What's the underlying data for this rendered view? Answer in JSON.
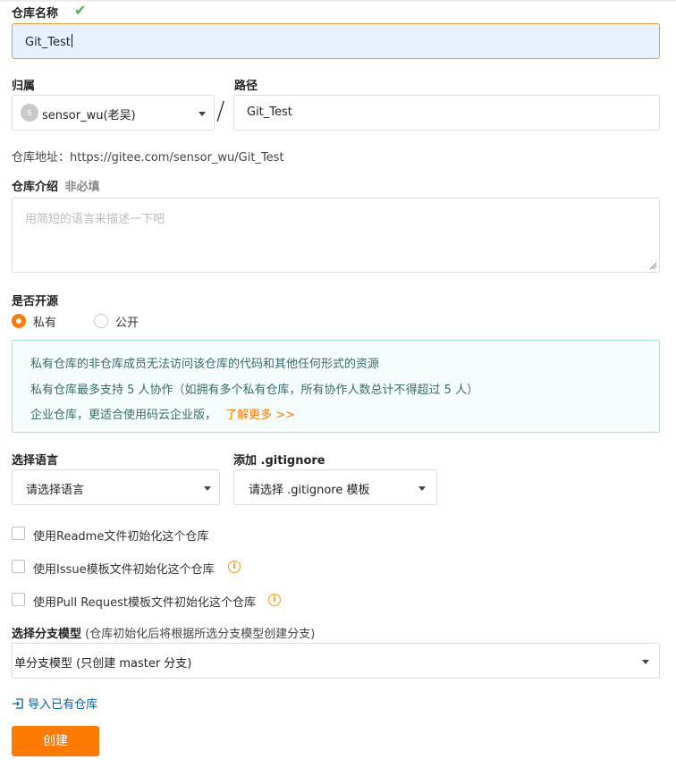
{
  "repo_name": {
    "label": "仓库名称",
    "value": "Git_Test"
  },
  "owner": {
    "label": "归属",
    "avatar_letter": "s",
    "value": "sensor_wu(老吴)"
  },
  "path": {
    "label": "路径",
    "value": "Git_Test",
    "separator": "/"
  },
  "repo_address": "仓库地址：https://gitee.com/sensor_wu/Git_Test",
  "description": {
    "label": "仓库介绍",
    "optional": "非必填",
    "placeholder": "用简短的语言来描述一下吧"
  },
  "visibility": {
    "label": "是否开源",
    "options": [
      {
        "label": "私有",
        "selected": true
      },
      {
        "label": "公开",
        "selected": false
      }
    ]
  },
  "private_notice": {
    "line1": "私有仓库的非仓库成员无法访问该仓库的代码和其他任何形式的资源",
    "line2": "私有仓库最多支持 5 人协作（如拥有多个私有仓库，所有协作人数总计不得超过 5 人）",
    "line3": "企业仓库，更适合使用码云企业版，",
    "learn_more": "了解更多 >>"
  },
  "language": {
    "label": "选择语言",
    "value": "请选择语言"
  },
  "gitignore": {
    "label": "添加 .gitignore",
    "value": "请选择 .gitignore 模板"
  },
  "init_options": [
    {
      "label": "使用Readme文件初始化这个仓库",
      "checked": false,
      "info": false
    },
    {
      "label": "使用Issue模板文件初始化这个仓库",
      "checked": false,
      "info": true
    },
    {
      "label": "使用Pull Request模板文件初始化这个仓库",
      "checked": false,
      "info": true
    }
  ],
  "branch_model": {
    "label": "选择分支模型",
    "hint": "(仓库初始化后将根据所选分支模型创建分支)",
    "value": "单分支模型 (只创建 master 分支)"
  },
  "import_link": "导入已有仓库",
  "create_button": "创建",
  "colors": {
    "accent": "#ff7a00",
    "success": "#4caf50",
    "link": "#0e5d9a"
  }
}
